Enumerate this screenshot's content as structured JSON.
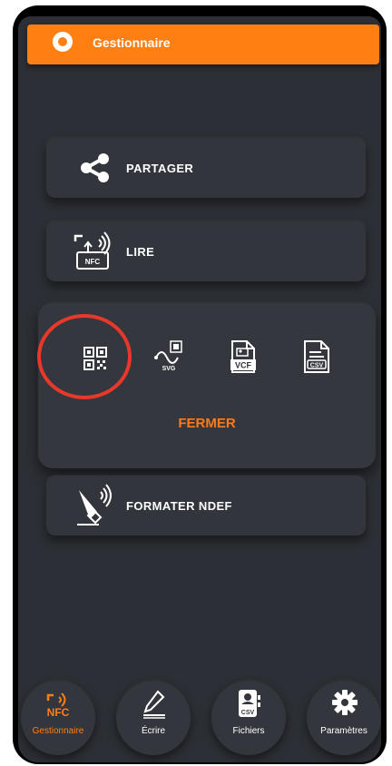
{
  "app": {
    "title": "Gestionnaire"
  },
  "actions": {
    "share_label": "PARTAGER",
    "read_label": "LIRE",
    "format_label": "FORMATER NDEF"
  },
  "read_icon": {
    "badge_text": "NFC"
  },
  "export_panel": {
    "options": [
      {
        "name": "qr-code",
        "label": ""
      },
      {
        "name": "svg",
        "label": "SVG"
      },
      {
        "name": "vcf",
        "label": "VCF"
      },
      {
        "name": "csv",
        "label": "CSV"
      }
    ],
    "close_label": "FERMER"
  },
  "bottom_nav": [
    {
      "icon_text": "NFC",
      "label": "Gestionnaire",
      "active": true
    },
    {
      "icon_text": "",
      "label": "Écrire",
      "active": false
    },
    {
      "icon_text": "CSV",
      "label": "Fichiers",
      "active": false
    },
    {
      "icon_text": "",
      "label": "Paramètres",
      "active": false
    }
  ],
  "colors": {
    "accent": "#ff7f12",
    "background": "#2c2f35",
    "card": "#32353b",
    "highlight_ring": "#e8382b"
  }
}
